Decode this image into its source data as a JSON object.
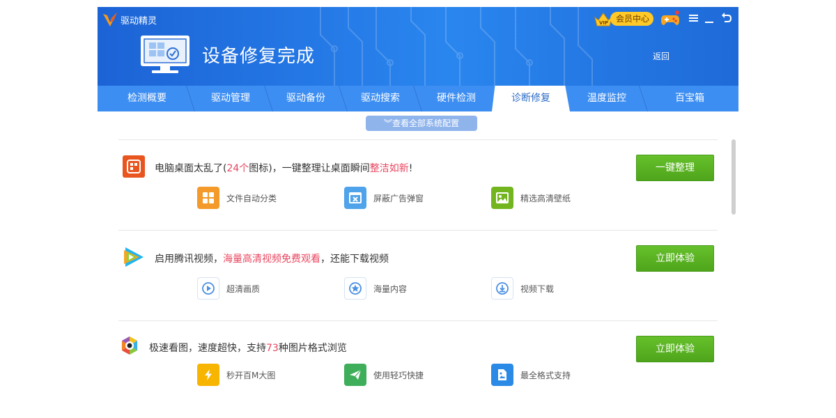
{
  "app": {
    "name": "驱动精灵"
  },
  "header": {
    "vip_label": "会员中心",
    "title": "设备修复完成",
    "back_label": "返回"
  },
  "tabs": [
    {
      "label": "检测概要"
    },
    {
      "label": "驱动管理"
    },
    {
      "label": "驱动备份"
    },
    {
      "label": "驱动搜索"
    },
    {
      "label": "硬件检测"
    },
    {
      "label": "诊断修复",
      "active": true
    },
    {
      "label": "温度监控"
    },
    {
      "label": "百宝箱"
    }
  ],
  "view_all_label": "查看全部系统配置",
  "rows": [
    {
      "icon": "desktop-organizer-icon",
      "text_before": "电脑桌面太乱了(",
      "highlight1": "24个",
      "text_mid": "图标)，一键整理让桌面瞬间",
      "highlight2": "整洁如新",
      "text_after": "!",
      "button": "一键整理",
      "features": [
        {
          "label": "文件自动分类",
          "icon": "grid-icon",
          "color": "#f39a2a"
        },
        {
          "label": "屏蔽广告弹窗",
          "icon": "block-popup-icon",
          "color": "#4fa3ea"
        },
        {
          "label": "精选高清壁纸",
          "icon": "wallpaper-icon",
          "color": "#72b51e"
        }
      ]
    },
    {
      "icon": "tencent-video-icon",
      "text_before": "启用腾讯视频，",
      "highlight1": "海量高清视频免费观看",
      "text_mid": "，还能下载视频",
      "button": "立即体验",
      "features": [
        {
          "label": "超清画质",
          "icon": "play-circle-icon"
        },
        {
          "label": "海量内容",
          "icon": "star-circle-icon"
        },
        {
          "label": "视频下载",
          "icon": "download-icon"
        }
      ]
    },
    {
      "icon": "image-viewer-icon",
      "text_before": "极速看图，速度超快，支持",
      "highlight1": "73",
      "text_mid": "种图片格式浏览",
      "button": "立即体验",
      "features": [
        {
          "label": "秒开百M大图",
          "icon": "lightning-icon",
          "color": "#f7b500"
        },
        {
          "label": "使用轻巧快捷",
          "icon": "paper-plane-icon",
          "color": "#3fae5b"
        },
        {
          "label": "最全格式支持",
          "icon": "image-file-icon",
          "color": "#2a8ae6"
        }
      ]
    }
  ],
  "colors": {
    "header": "#2a86ef",
    "tab_bar": "#3d8ef2",
    "highlight": "#e8455f",
    "cta_green": "#5bb324"
  }
}
